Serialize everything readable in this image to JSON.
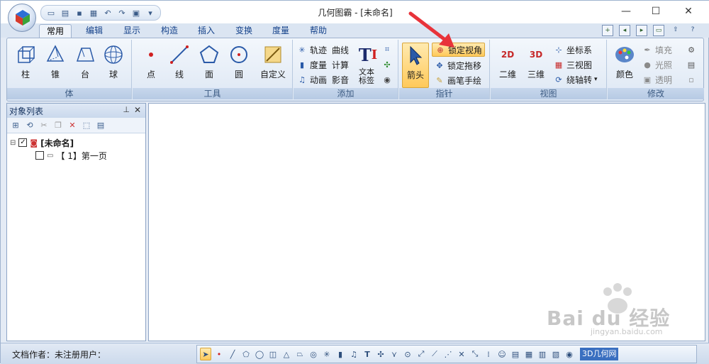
{
  "window": {
    "title": "几何图霸 - [未命名]",
    "buttons": {
      "minimize": "—",
      "maximize": "☐",
      "close": "✕"
    }
  },
  "ribbon": {
    "tabs": [
      "常用",
      "编辑",
      "显示",
      "构造",
      "插入",
      "变换",
      "度量",
      "帮助"
    ],
    "active_tab": "常用",
    "groups": {
      "body": {
        "label": "体",
        "buttons": [
          "柱",
          "锥",
          "台",
          "球"
        ]
      },
      "tools": {
        "label": "工具",
        "buttons": [
          "点",
          "线",
          "面",
          "圆",
          "自定义"
        ]
      },
      "add": {
        "label": "添加",
        "items": [
          "轨迹",
          "曲线",
          "度量",
          "计算",
          "动画",
          "影音",
          "文本标签"
        ]
      },
      "pointer": {
        "label": "指针",
        "arrow": "箭头",
        "items": [
          "锁定视角",
          "锁定拖移",
          "画笔手绘"
        ]
      },
      "view": {
        "label": "视图",
        "buttons": [
          "二维",
          "三维"
        ],
        "items": [
          "坐标系",
          "三视图",
          "绕轴转"
        ]
      },
      "modify": {
        "label": "修改",
        "color": "颜色",
        "items": [
          "填充",
          "光照",
          "透明"
        ]
      }
    }
  },
  "panel": {
    "title": "对象列表",
    "tree": [
      {
        "label": "[未命名]",
        "checked": true
      },
      {
        "label": "【 1】第一页",
        "checked": false
      }
    ]
  },
  "status": {
    "author": "文档作者：未注册用户："
  },
  "bottom_link": "3D几何网",
  "watermark": {
    "brand": "Bai du 经验",
    "url": "jingyan.baidu.com"
  },
  "colors": {
    "accent": "#15428b",
    "selected": "#ffc95a",
    "arrow": "#e8333a"
  }
}
